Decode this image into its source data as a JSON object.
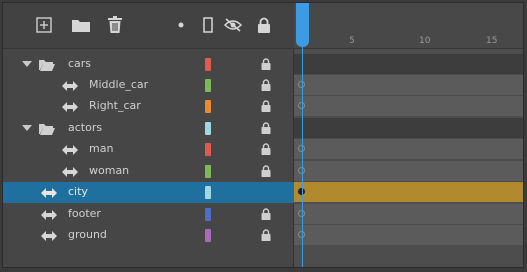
{
  "toolbar": {
    "buttons": [
      {
        "icon": "new-layer-icon"
      },
      {
        "icon": "new-folder-icon"
      },
      {
        "icon": "delete-icon"
      },
      {
        "icon": "active-dot-icon"
      },
      {
        "icon": "outline-icon"
      },
      {
        "icon": "visibility-icon"
      },
      {
        "icon": "lock-icon"
      }
    ]
  },
  "colors": {
    "selected_row": "#1f6f9f",
    "selected_frames": "#b08a2c",
    "playhead": "#3c9be2"
  },
  "layers": [
    {
      "label": "cars",
      "type": "folder",
      "expanded": true,
      "swatch": "#e05a4f",
      "locked": true
    },
    {
      "label": "Middle_car",
      "type": "layer",
      "swatch": "#7dbb59",
      "locked": true
    },
    {
      "label": "Right_car",
      "type": "layer",
      "swatch": "#ee8a2e",
      "locked": true
    },
    {
      "label": "actors",
      "type": "folder",
      "expanded": true,
      "swatch": "#9fd8e0",
      "locked": true
    },
    {
      "label": "man",
      "type": "layer",
      "swatch": "#e05a4f",
      "locked": true
    },
    {
      "label": "woman",
      "type": "layer",
      "swatch": "#7dbb59",
      "locked": true
    },
    {
      "label": "city",
      "type": "layer",
      "swatch": "#9fd8e0",
      "locked": false,
      "selected": true
    },
    {
      "label": "footer",
      "type": "layer",
      "swatch": "#4f6fc4",
      "locked": true
    },
    {
      "label": "ground",
      "type": "layer",
      "swatch": "#a96bb8",
      "locked": true
    }
  ],
  "timeline": {
    "ruler_numbers": [
      "5",
      "10",
      "15"
    ]
  }
}
